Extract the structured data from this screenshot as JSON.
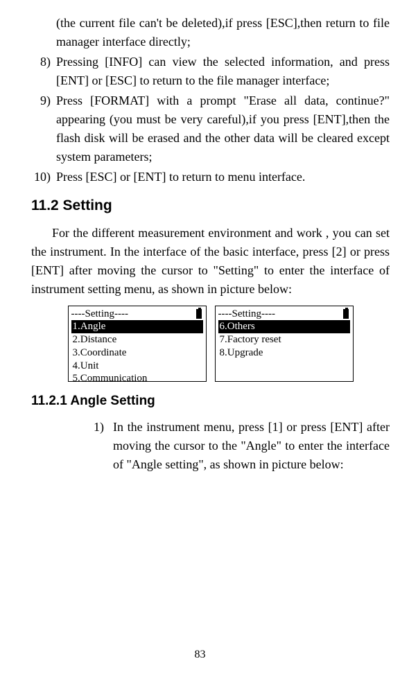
{
  "items": {
    "line7": "(the current file can't be deleted),if press [ESC],then return to file manager interface directly;",
    "num8": "8)",
    "text8": "Pressing [INFO] can view the selected information, and press [ENT] or [ESC] to return to the file manager interface;",
    "num9": "9)",
    "text9": "Press [FORMAT] with a prompt \"Erase all data, continue?\" appearing (you must be very careful),if you press [ENT],then the flash disk will be erased and the other data will be cleared except system parameters;",
    "num10": "10)",
    "text10": "Press [ESC] or [ENT] to return to menu interface."
  },
  "heading1": "11.2 Setting",
  "para1": "For the different measurement environment and work , you can set the instrument. In the interface of the basic interface, press [2] or press [ENT] after moving the cursor to \"Setting\" to enter the interface of instrument setting menu, as shown in picture below:",
  "screen1": {
    "title": "----Setting----",
    "opt1": "1.Angle",
    "opt2": "2.Distance",
    "opt3": "3.Coordinate",
    "opt4": "4.Unit",
    "opt5": "5.Communication"
  },
  "screen2": {
    "title": "----Setting----",
    "opt6": "6.Others",
    "opt7": "7.Factory reset",
    "opt8": "8.Upgrade"
  },
  "heading2": "11.2.1 Angle Setting",
  "sub": {
    "num1": "1)",
    "text1": "In the instrument menu, press [1] or press [ENT] after moving the cursor to the \"Angle\" to enter the interface of \"Angle setting\", as shown in picture below:"
  },
  "pageNum": "83"
}
